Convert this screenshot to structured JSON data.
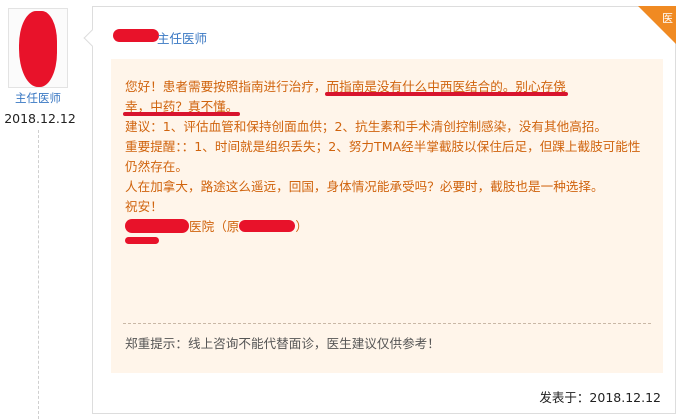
{
  "left": {
    "role": "主任医师",
    "date": "2018.12.12"
  },
  "card": {
    "corner_badge": "医",
    "doctor_role": "主任医师",
    "message": {
      "line1_a": "您好！患者需要按照指南进行治疗，",
      "line1_hl": "而指南是没有什么中西医结合的。别心存侥",
      "line2_hl": "幸，中药？真不懂。",
      "line3": "建议：1、评估血管和保持创面血供；2、抗生素和手术清创控制感染，没有其他高招。",
      "line4": "重要提醒：：1、时间就是组织丢失；2、努力TMA经半掌截肢以保住后足，但踝上截肢可能性仍然存在。",
      "line5": "人在加拿大，路途这么遥远，回国，身体情况能承受吗？必要时，截肢也是一种选择。",
      "line6": "祝安！",
      "hospital_a": "医院（原",
      "hospital_b": "）"
    },
    "notice": "郑重提示：线上咨询不能代替面诊，医生建议仅供参考！",
    "posted": "发表于：2018.12.12"
  },
  "colors": {
    "accent_orange": "#d0640e",
    "link_blue": "#3a78c3",
    "message_bg": "#fff5ea",
    "corner": "#f08a22",
    "redaction": "#e8122a"
  }
}
